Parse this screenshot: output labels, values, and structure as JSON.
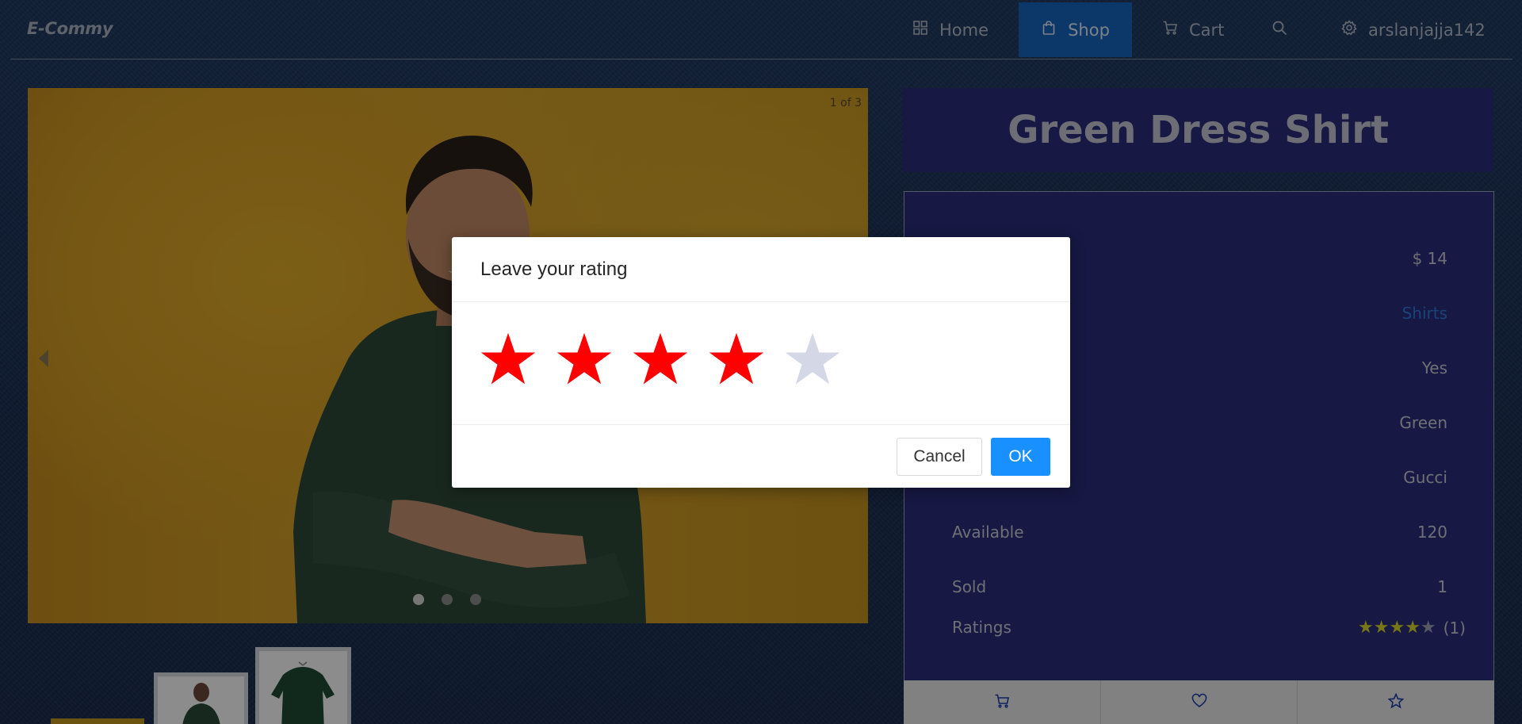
{
  "header": {
    "logo": "E-Commy",
    "nav": {
      "home": "Home",
      "shop": "Shop",
      "cart": "Cart",
      "user": "arslanjajja142"
    }
  },
  "carousel": {
    "counter": "1 of 3",
    "slides_total": 3,
    "active_slide": 1
  },
  "product": {
    "title": "Green Dress Shirt",
    "details": [
      {
        "label": "",
        "value": "$ 14",
        "link": false
      },
      {
        "label": "",
        "value": "Shirts",
        "link": true
      },
      {
        "label": "",
        "value": "Yes",
        "link": false
      },
      {
        "label": "",
        "value": "Green",
        "link": false
      },
      {
        "label": "",
        "value": "Gucci",
        "link": false
      },
      {
        "label": "Available",
        "value": "120",
        "link": false
      },
      {
        "label": "Sold",
        "value": "1",
        "link": false
      }
    ],
    "ratings": {
      "label": "Ratings",
      "stars": 4,
      "max": 5,
      "count_text": "(1)"
    }
  },
  "modal": {
    "title": "Leave your rating",
    "selected_stars": 4,
    "max_stars": 5,
    "cancel_label": "Cancel",
    "ok_label": "OK"
  },
  "colors": {
    "active_star": "#ff0000",
    "inactive_star": "#d4d8e6",
    "primary": "#1890ff",
    "shop_tab": "#1764c0",
    "panel": "#2a2c7a"
  },
  "icons": {
    "home": "grid-icon",
    "shop": "shopping-bag-icon",
    "cart": "cart-icon",
    "search": "search-icon",
    "user": "gear-icon"
  }
}
